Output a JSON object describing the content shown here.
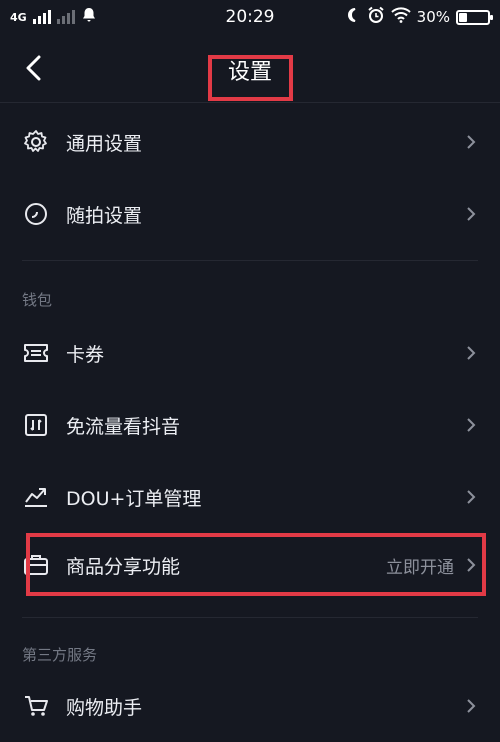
{
  "status_bar": {
    "network": "4G",
    "time": "20:29",
    "battery_percent": "30%",
    "battery_level": 0.3,
    "icons": [
      "signal-icon",
      "signal-icon",
      "notification-bell-icon",
      "moon-icon",
      "alarm-icon",
      "wifi-icon",
      "battery-icon"
    ]
  },
  "header": {
    "title": "设置",
    "back_icon": "back-chevron-icon"
  },
  "settings": {
    "general": {
      "label": "通用设置",
      "icon": "gear-icon"
    },
    "capture": {
      "label": "随拍设置",
      "icon": "camera-circle-icon"
    }
  },
  "wallet": {
    "section_label": "钱包",
    "items": [
      {
        "label": "卡券",
        "icon": "ticket-icon",
        "value": ""
      },
      {
        "label": "免流量看抖音",
        "icon": "data-card-icon",
        "value": ""
      },
      {
        "label": "DOU+订单管理",
        "icon": "trend-chart-icon",
        "value": ""
      },
      {
        "label": "商品分享功能",
        "icon": "briefcase-icon",
        "value": "立即开通"
      }
    ]
  },
  "third_party": {
    "section_label": "第三方服务",
    "items": [
      {
        "label": "购物助手",
        "icon": "shopping-cart-icon"
      }
    ]
  },
  "colors": {
    "background": "#151821",
    "highlight": "#e23a46",
    "text": "#eceef3",
    "muted": "#737884"
  }
}
